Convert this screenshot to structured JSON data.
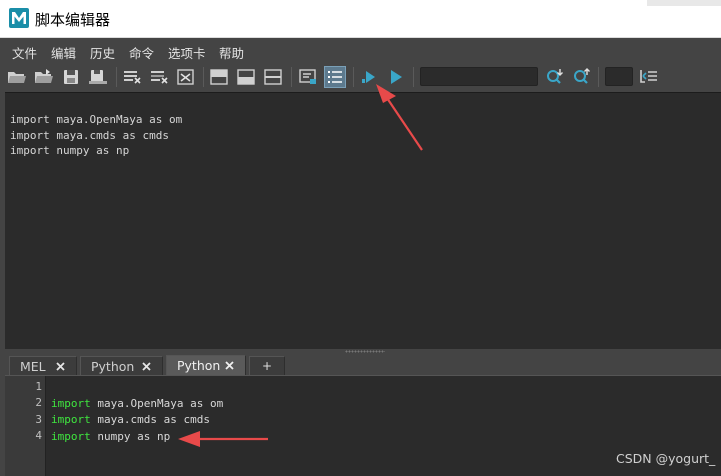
{
  "window": {
    "title": "脚本编辑器",
    "app_icon": "maya-icon"
  },
  "menu": {
    "items": [
      "文件",
      "编辑",
      "历史",
      "命令",
      "选项卡",
      "帮助"
    ]
  },
  "toolbar": {
    "icons": [
      "open-script-icon",
      "source-script-icon",
      "save-script-icon",
      "save-script-to-shelf-icon",
      "clear-history-icon",
      "clear-input-icon",
      "clear-all-icon",
      "show-history-only-icon",
      "show-input-only-icon",
      "show-both-icon",
      "echo-all-commands-icon",
      "show-line-numbers-icon",
      "execute-all-icon",
      "execute-icon",
      "search-next-icon",
      "search-prev-icon",
      "goto-line-icon"
    ],
    "search_value": "",
    "line_value": ""
  },
  "output": {
    "lines": [
      "import maya.OpenMaya as om",
      "import maya.cmds as cmds",
      "import numpy as np"
    ]
  },
  "tabs": [
    {
      "label": "MEL",
      "active": false
    },
    {
      "label": "Python",
      "active": false
    },
    {
      "label": "Python",
      "active": true
    }
  ],
  "tab_add_label": "+",
  "editor": {
    "line_numbers": [
      "1",
      "2",
      "3",
      "4"
    ],
    "lines": [
      {
        "keyword": "",
        "rest": ""
      },
      {
        "keyword": "import",
        "rest": " maya.OpenMaya as om"
      },
      {
        "keyword": "import",
        "rest": " maya.cmds as cmds"
      },
      {
        "keyword": "import",
        "rest": " numpy as np"
      }
    ]
  },
  "watermark": "CSDN @yogurt_",
  "colors": {
    "keyword": "#3fe63f",
    "annotation_arrow": "#e84a4a",
    "accent": "#3aa6c8"
  }
}
